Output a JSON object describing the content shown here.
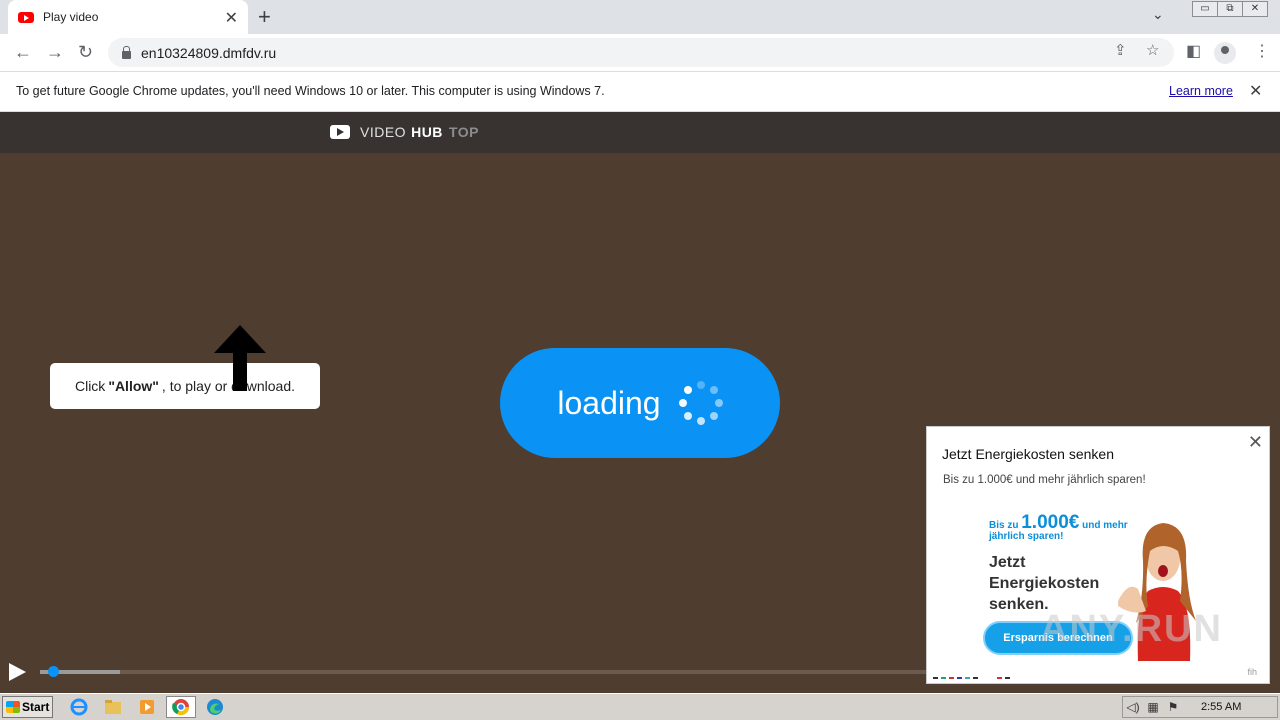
{
  "browser": {
    "tab_title": "Play video",
    "tab_close": "✕",
    "new_tab": "+",
    "tab_search": "⌄",
    "window_buttons": [
      "▭",
      "⧉",
      "✕"
    ],
    "url": "en10324809.dmfdv.ru",
    "nav": {
      "back": "←",
      "forward": "→",
      "reload": "↻"
    },
    "omni_icons": {
      "share": "⇪",
      "bookmark": "☆"
    },
    "toolbar_icons": {
      "side_panel": "◧",
      "menu": "⋮"
    }
  },
  "infobar": {
    "message": "To get future Google Chrome updates, you'll need Windows 10 or later. This computer is using Windows 7.",
    "learn_more": "Learn more",
    "close": "✕"
  },
  "site": {
    "logo_word1": "VIDEO",
    "logo_word2": "HUB",
    "logo_word3": "TOP",
    "hint_pre": "Click",
    "hint_bold": "\"Allow\"",
    "hint_post": ", to play or download.",
    "loading_text": "loading"
  },
  "player": {
    "progress": 0.01,
    "buffered": 0.09
  },
  "ad": {
    "close": "✕",
    "title": "Jetzt Energiekosten senken",
    "subtitle": "Bis zu 1.000€ und mehr jährlich sparen!",
    "banner_line1_pre": "Bis zu",
    "banner_amount": "1.000€",
    "banner_line1_post": "und mehr",
    "banner_line2": "jährlich sparen!",
    "banner_headline": [
      "Jetzt",
      "Energiekosten",
      "senken."
    ],
    "banner_cta": "Ersparnis berechnen",
    "footer": "fih"
  },
  "taskbar": {
    "start_label": "Start",
    "apps": [
      "internet-explorer",
      "file-explorer",
      "media-player",
      "chrome",
      "edge"
    ],
    "clock": "2:55 AM"
  },
  "watermark": "ANY.RUN"
}
